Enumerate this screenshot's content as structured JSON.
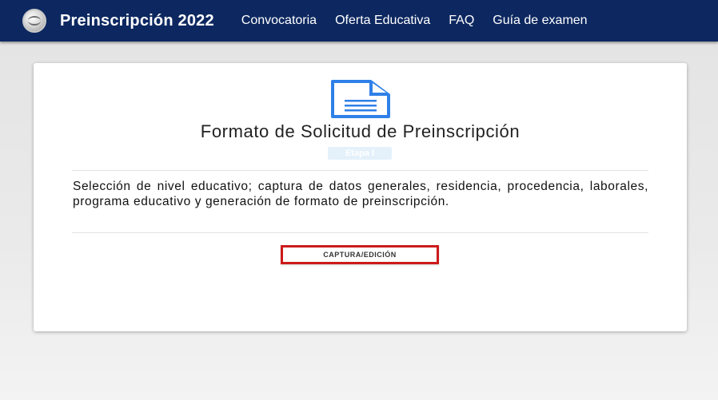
{
  "navbar": {
    "brand": "Preinscripción 2022",
    "links": [
      {
        "label": "Convocatoria"
      },
      {
        "label": "Oferta Educativa"
      },
      {
        "label": "FAQ"
      },
      {
        "label": "Guía de examen"
      }
    ]
  },
  "card": {
    "icon": "document-icon",
    "title": "Formato de Solicitud de Preinscripción",
    "stage": "Etapa I",
    "description": "Selección de nivel educativo; captura de datos generales, residencia, procedencia, laborales, programa educativo y generación de formato de preinscripción.",
    "button_label": "CAPTURA/EDICIÓN"
  },
  "colors": {
    "navbar_bg": "#0d2860",
    "icon_blue": "#2f80e8",
    "button_border": "#cc1a1a"
  }
}
